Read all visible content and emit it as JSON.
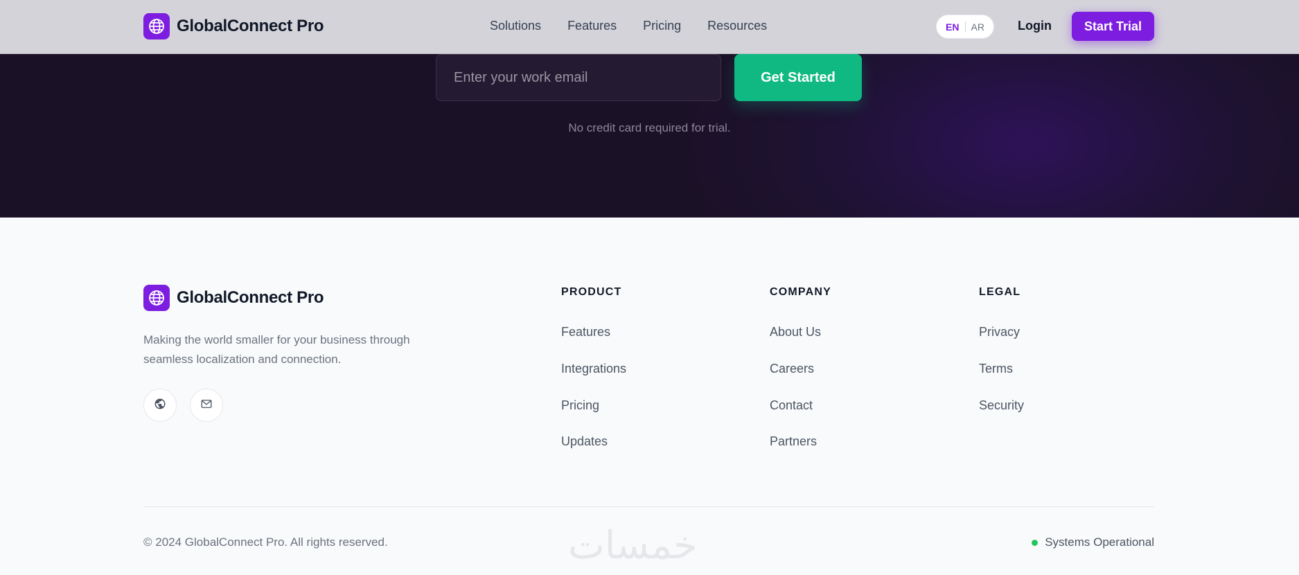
{
  "header": {
    "brand_name": "GlobalConnect Pro",
    "nav": [
      "Solutions",
      "Features",
      "Pricing",
      "Resources"
    ],
    "lang_en": "EN",
    "lang_ar": "AR",
    "login": "Login",
    "start_trial": "Start Trial"
  },
  "cta": {
    "email_placeholder": "Enter your work email",
    "get_started": "Get Started",
    "note": "No credit card required for trial."
  },
  "footer": {
    "brand_name": "GlobalConnect Pro",
    "description": "Making the world smaller for your business through seamless localization and connection.",
    "social_icons": [
      "globe-icon",
      "mail-icon"
    ],
    "columns": [
      {
        "title": "PRODUCT",
        "links": [
          "Features",
          "Integrations",
          "Pricing",
          "Updates"
        ]
      },
      {
        "title": "COMPANY",
        "links": [
          "About Us",
          "Careers",
          "Contact",
          "Partners"
        ]
      },
      {
        "title": "LEGAL",
        "links": [
          "Privacy",
          "Terms",
          "Security"
        ]
      }
    ],
    "copyright": "© 2024 GlobalConnect Pro. All rights reserved.",
    "watermark": "خمسات",
    "status": "Systems Operational"
  },
  "colors": {
    "brand_purple": "#7c1de0",
    "cta_green": "#10b981",
    "status_green": "#22c55e",
    "dark_band": "#1b1126"
  }
}
